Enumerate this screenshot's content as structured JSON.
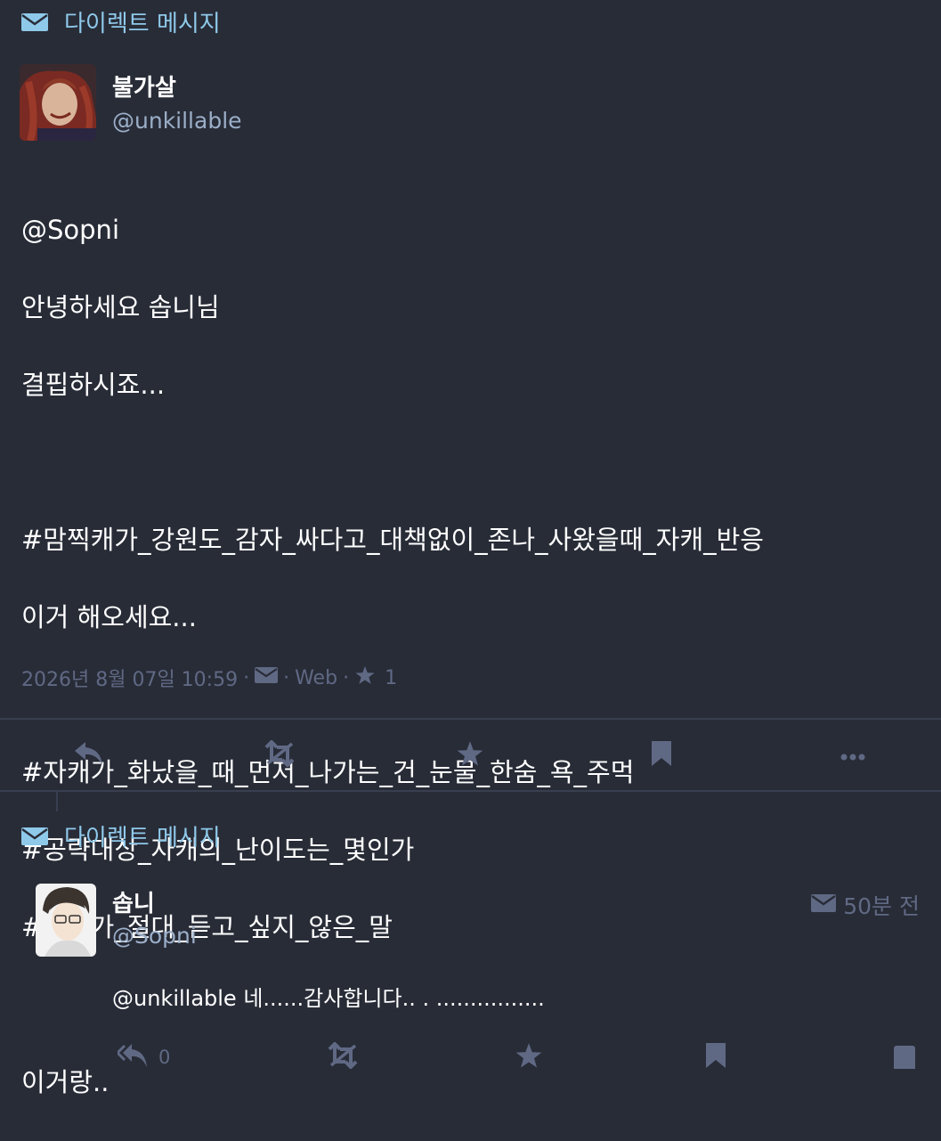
{
  "status": {
    "context_label": "다이렉트 메시지",
    "author": {
      "display_name": "불가살",
      "handle": "@unkillable"
    },
    "content_lines": [
      "@Sopni",
      "안녕하세요 솝니님",
      "결핍하시죠...",
      "",
      "#맘찍캐가_강원도_감자_싸다고_대책없이_존나_사왔을때_자캐_반응",
      "이거 해오세요...",
      "",
      "#자캐가_화났을_때_먼저_나가는_건_눈물_한숨_욕_주먹",
      "#공략대상_자캐의_난이도는_몇인가",
      "#자캐가_절대_듣고_싶지_않은_말",
      "",
      "이거랑.."
    ],
    "meta": {
      "datetime": "2026년 8월 07일 10:59",
      "sep": "·",
      "visibility_icon": "envelope-icon",
      "app": "Web",
      "fav_icon": "star-icon",
      "fav_count": "1"
    },
    "actions": [
      "reply-icon",
      "boost-disabled-icon",
      "star-icon",
      "bookmark-icon",
      "more-icon"
    ]
  },
  "reply": {
    "context_label": "다이렉트 메시지",
    "author": {
      "display_name": "솝니",
      "handle": "@Sopni"
    },
    "time": "50분 전",
    "content": "@unkillable 네......감사합니다.. . ................",
    "reply_count": "0"
  },
  "colors": {
    "background": "#282c37",
    "divider": "#393f4f",
    "muted": "#606984",
    "handle": "#9baec8",
    "context": "#8fc9ea"
  }
}
